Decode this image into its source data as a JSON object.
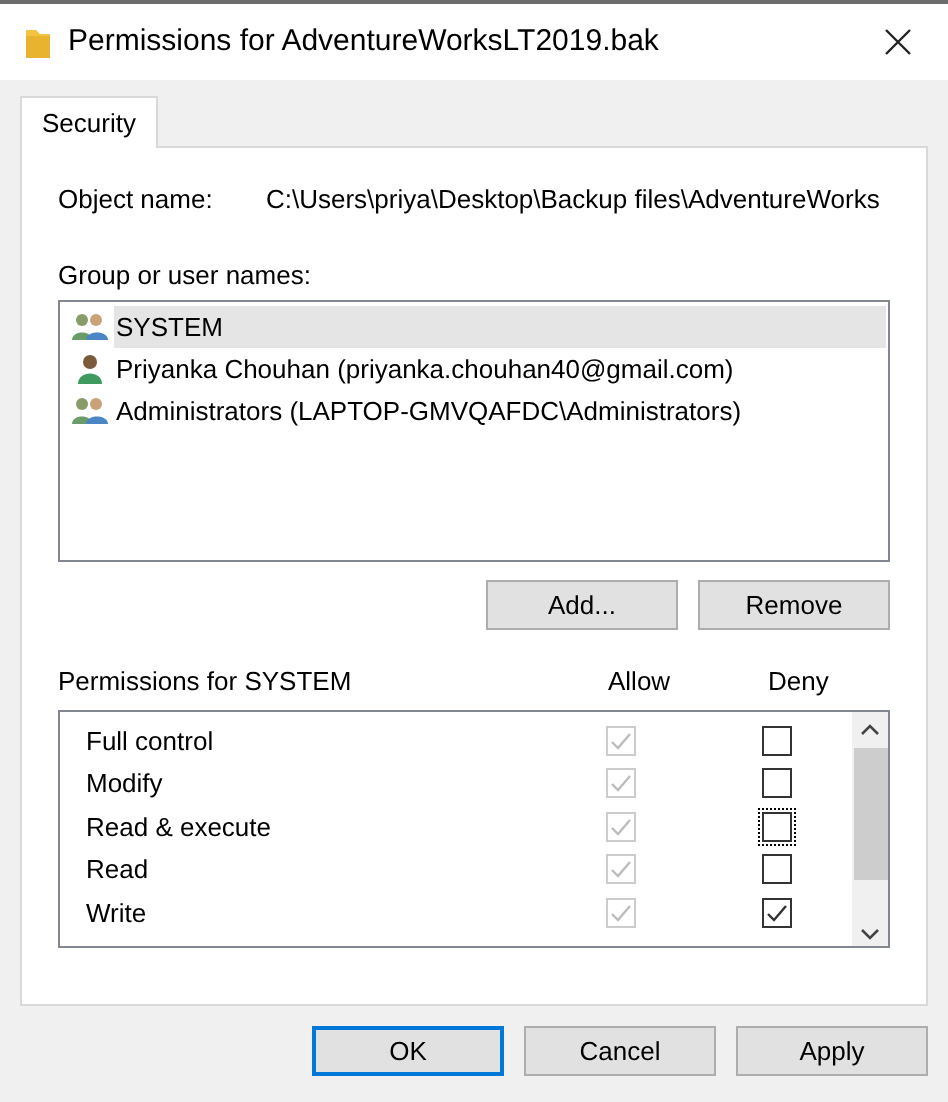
{
  "window": {
    "title": "Permissions for AdventureWorksLT2019.bak"
  },
  "tabs": [
    {
      "label": "Security",
      "selected": true
    }
  ],
  "object_name": {
    "label": "Object name:",
    "value": "C:\\Users\\priya\\Desktop\\Backup files\\AdventureWorks"
  },
  "group_list": {
    "label": "Group or user names:",
    "items": [
      {
        "name": "SYSTEM",
        "kind": "group",
        "selected": true
      },
      {
        "name": "Priyanka Chouhan (priyanka.chouhan40@gmail.com)",
        "kind": "user",
        "selected": false
      },
      {
        "name": "Administrators (LAPTOP-GMVQAFDC\\Administrators)",
        "kind": "group",
        "selected": false
      }
    ]
  },
  "group_buttons": [
    "Add...",
    "Remove"
  ],
  "permissions": {
    "label": "Permissions for SYSTEM",
    "allow_header": "Allow",
    "deny_header": "Deny",
    "rows": [
      {
        "name": "Full control",
        "allow": true,
        "allow_disabled": true,
        "deny": false,
        "focused": false
      },
      {
        "name": "Modify",
        "allow": true,
        "allow_disabled": true,
        "deny": false,
        "focused": false
      },
      {
        "name": "Read & execute",
        "allow": true,
        "allow_disabled": true,
        "deny": false,
        "focused": true
      },
      {
        "name": "Read",
        "allow": true,
        "allow_disabled": true,
        "deny": false,
        "focused": false
      },
      {
        "name": "Write",
        "allow": true,
        "allow_disabled": true,
        "deny": true,
        "focused": false
      }
    ]
  },
  "dialog_buttons": [
    {
      "label": "OK",
      "default": true
    },
    {
      "label": "Cancel",
      "default": false
    },
    {
      "label": "Apply",
      "default": false
    }
  ]
}
